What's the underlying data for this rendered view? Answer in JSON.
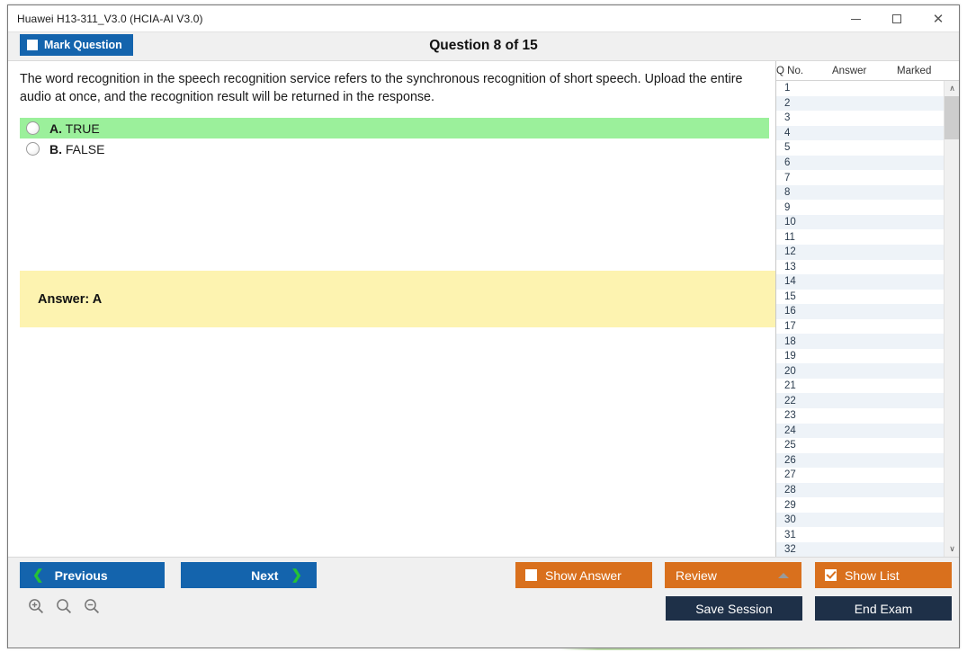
{
  "window": {
    "title": "Huawei H13-311_V3.0 (HCIA-AI V3.0)",
    "minimize_label": "─",
    "maximize_label": "",
    "close_label": "✕"
  },
  "header": {
    "mark_question_label": "Mark Question",
    "mark_question_checked": false,
    "question_counter": "Question 8 of 15"
  },
  "question": {
    "text": "The word recognition in the speech recognition service refers to the synchronous recognition of short speech. Upload the entire audio at once, and the recognition result will be returned in the response.",
    "options": [
      {
        "letter": "A.",
        "text": "TRUE",
        "correct": true,
        "selected": false
      },
      {
        "letter": "B.",
        "text": "FALSE",
        "correct": false,
        "selected": false
      }
    ],
    "answer_label": "Answer: A"
  },
  "list_panel": {
    "columns": [
      "Q No.",
      "Answer",
      "Marked"
    ],
    "rows": [
      {
        "qno": "1",
        "answer": "",
        "marked": ""
      },
      {
        "qno": "2",
        "answer": "",
        "marked": ""
      },
      {
        "qno": "3",
        "answer": "",
        "marked": ""
      },
      {
        "qno": "4",
        "answer": "",
        "marked": ""
      },
      {
        "qno": "5",
        "answer": "",
        "marked": ""
      },
      {
        "qno": "6",
        "answer": "",
        "marked": ""
      },
      {
        "qno": "7",
        "answer": "",
        "marked": ""
      },
      {
        "qno": "8",
        "answer": "",
        "marked": ""
      },
      {
        "qno": "9",
        "answer": "",
        "marked": ""
      },
      {
        "qno": "10",
        "answer": "",
        "marked": ""
      },
      {
        "qno": "11",
        "answer": "",
        "marked": ""
      },
      {
        "qno": "12",
        "answer": "",
        "marked": ""
      },
      {
        "qno": "13",
        "answer": "",
        "marked": ""
      },
      {
        "qno": "14",
        "answer": "",
        "marked": ""
      },
      {
        "qno": "15",
        "answer": "",
        "marked": ""
      },
      {
        "qno": "16",
        "answer": "",
        "marked": ""
      },
      {
        "qno": "17",
        "answer": "",
        "marked": ""
      },
      {
        "qno": "18",
        "answer": "",
        "marked": ""
      },
      {
        "qno": "19",
        "answer": "",
        "marked": ""
      },
      {
        "qno": "20",
        "answer": "",
        "marked": ""
      },
      {
        "qno": "21",
        "answer": "",
        "marked": ""
      },
      {
        "qno": "22",
        "answer": "",
        "marked": ""
      },
      {
        "qno": "23",
        "answer": "",
        "marked": ""
      },
      {
        "qno": "24",
        "answer": "",
        "marked": ""
      },
      {
        "qno": "25",
        "answer": "",
        "marked": ""
      },
      {
        "qno": "26",
        "answer": "",
        "marked": ""
      },
      {
        "qno": "27",
        "answer": "",
        "marked": ""
      },
      {
        "qno": "28",
        "answer": "",
        "marked": ""
      },
      {
        "qno": "29",
        "answer": "",
        "marked": ""
      },
      {
        "qno": "30",
        "answer": "",
        "marked": ""
      },
      {
        "qno": "31",
        "answer": "",
        "marked": ""
      },
      {
        "qno": "32",
        "answer": "",
        "marked": ""
      }
    ],
    "scroll_up_glyph": "∧",
    "scroll_down_glyph": "∨"
  },
  "footer": {
    "previous_label": "Previous",
    "previous_chevron": "❮",
    "next_label": "Next",
    "next_chevron": "❯",
    "show_answer_label": "Show Answer",
    "show_answer_checked": false,
    "review_label": "Review",
    "show_list_label": "Show List",
    "show_list_checked": true,
    "save_session_label": "Save Session",
    "end_exam_label": "End Exam",
    "zoom_in_name": "zoom-in",
    "zoom_reset_name": "zoom-reset",
    "zoom_out_name": "zoom-out"
  },
  "colors": {
    "primary_blue": "#1464ad",
    "orange": "#d9701d",
    "navy": "#1e3048",
    "correct_green": "#9bf09b",
    "answer_yellow": "#fdf3b0",
    "chevron_green": "#25c235"
  }
}
